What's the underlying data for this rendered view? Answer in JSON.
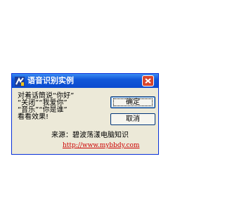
{
  "window": {
    "title": "语音识别实例",
    "close_icon": "close-icon",
    "app_icon": "speech-app-icon"
  },
  "message": {
    "lines": [
      "对着话筒说“你好”",
      "“关闭”“我爱你”",
      "“音乐”“你是谁”",
      "看看效果!"
    ]
  },
  "buttons": {
    "ok_label": "确定",
    "cancel_label": "取消"
  },
  "source": {
    "text": "来源：碧波荡漾电脑知识",
    "url": "http://www.mybbdy.com"
  },
  "colors": {
    "titlebar": "#0b4bcf",
    "dialog_face": "#ece9d8",
    "link": "#cc0000",
    "close_button": "#d8462d"
  }
}
